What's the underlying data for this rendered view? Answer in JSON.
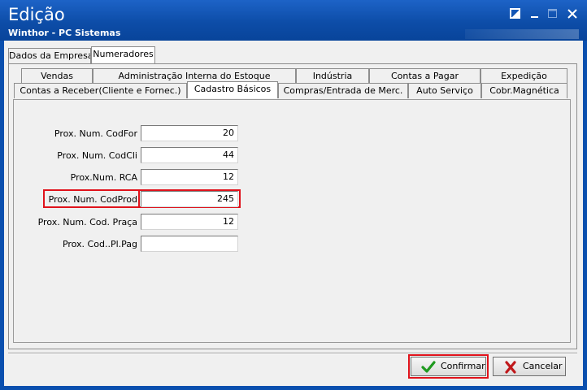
{
  "window": {
    "title": "Edição",
    "subtitle": "Winthor - PC Sistemas"
  },
  "outer_tabs": [
    {
      "label": "Dados da Empresa",
      "active": false
    },
    {
      "label": "Numeradores",
      "active": true
    }
  ],
  "inner_tabs_row1": [
    {
      "label": "Vendas"
    },
    {
      "label": "Administração Interna do Estoque"
    },
    {
      "label": "Indústria"
    },
    {
      "label": "Contas a Pagar"
    },
    {
      "label": "Expedição"
    }
  ],
  "inner_tabs_row2": [
    {
      "label": "Contas a Receber(Cliente e Fornec.)",
      "active": false
    },
    {
      "label": "Cadastro Básicos",
      "active": true
    },
    {
      "label": "Compras/Entrada de Merc.",
      "active": false
    },
    {
      "label": "Auto Serviço",
      "active": false
    },
    {
      "label": "Cobr.Magnética",
      "active": false
    }
  ],
  "fields": [
    {
      "label": "Prox. Num. CodFor",
      "value": "20"
    },
    {
      "label": "Prox. Num. CodCli",
      "value": "44"
    },
    {
      "label": "Prox.Num. RCA",
      "value": "12"
    },
    {
      "label": "Prox. Num. CodProd",
      "value": "245"
    },
    {
      "label": "Prox. Num. Cod. Praça",
      "value": "12"
    },
    {
      "label": "Prox. Cod..Pl.Pag",
      "value": ""
    }
  ],
  "buttons": {
    "confirm": "Confirmar",
    "cancel": "Cancelar"
  },
  "colors": {
    "highlight": "#e0121b",
    "confirm_icon": "#1f9a1f",
    "cancel_icon": "#c0181b"
  }
}
